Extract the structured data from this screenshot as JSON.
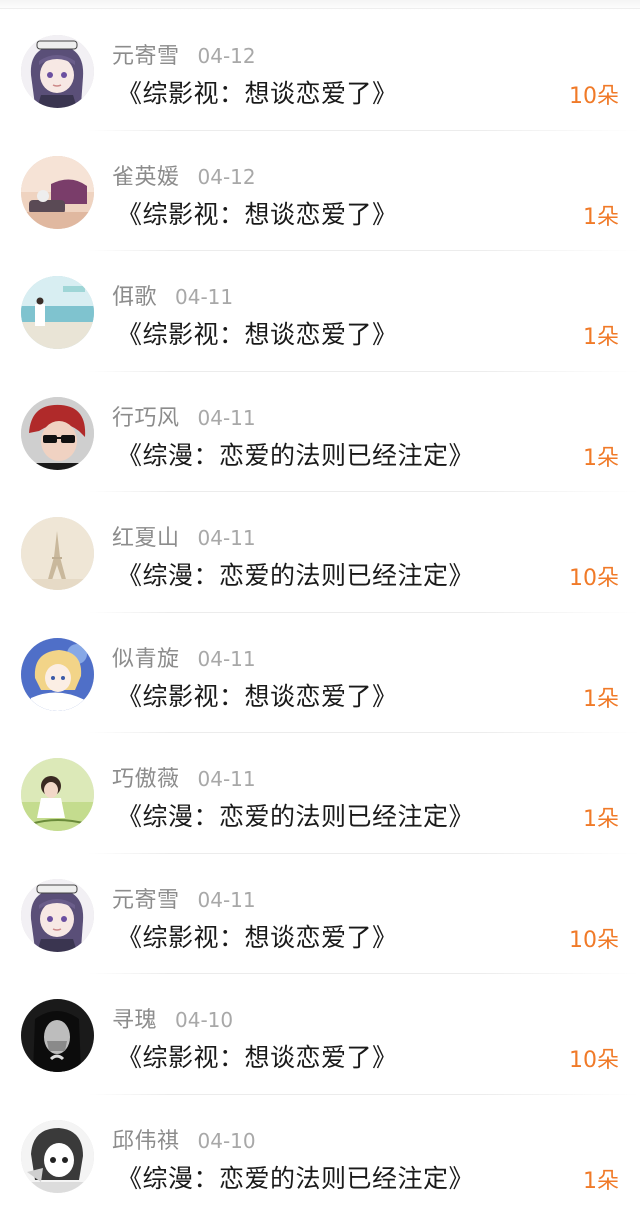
{
  "currency_unit": "朵",
  "records": [
    {
      "user": "元寄雪",
      "date": "04-12",
      "title": "《综影视：想谈恋爱了》",
      "amount": "10朵",
      "avatar": "anime-girl-purple-hair-icon"
    },
    {
      "user": "雀英媛",
      "date": "04-12",
      "title": "《综影视：想谈恋爱了》",
      "amount": "1朵",
      "avatar": "pink-room-photo-icon"
    },
    {
      "user": "佴歌",
      "date": "04-11",
      "title": "《综影视：想谈恋爱了》",
      "amount": "1朵",
      "avatar": "beach-girl-photo-icon"
    },
    {
      "user": "行巧风",
      "date": "04-11",
      "title": "《综漫：恋爱的法则已经注定》",
      "amount": "1朵",
      "avatar": "red-hair-boy-sunglasses-icon"
    },
    {
      "user": "红夏山",
      "date": "04-11",
      "title": "《综漫：恋爱的法则已经注定》",
      "amount": "10朵",
      "avatar": "eiffel-tower-sepia-icon"
    },
    {
      "user": "似青旋",
      "date": "04-11",
      "title": "《综影视：想谈恋爱了》",
      "amount": "1朵",
      "avatar": "anime-blonde-girl-icon"
    },
    {
      "user": "巧傲薇",
      "date": "04-11",
      "title": "《综漫：恋爱的法则已经注定》",
      "amount": "1朵",
      "avatar": "green-girl-photo-icon"
    },
    {
      "user": "元寄雪",
      "date": "04-11",
      "title": "《综影视：想谈恋爱了》",
      "amount": "10朵",
      "avatar": "anime-girl-purple-hair-icon"
    },
    {
      "user": "寻瑰",
      "date": "04-10",
      "title": "《综影视：想谈恋爱了》",
      "amount": "10朵",
      "avatar": "black-white-girl-photo-icon"
    },
    {
      "user": "邱伟祺",
      "date": "04-10",
      "title": "《综漫：恋爱的法则已经注定》",
      "amount": "1朵",
      "avatar": "manga-girl-sketch-icon"
    }
  ],
  "colors": {
    "username": "#8c8c8c",
    "date": "#a8a8a8",
    "title": "#1a1a1a",
    "amount": "#f07a28",
    "divider": "#ececec"
  }
}
